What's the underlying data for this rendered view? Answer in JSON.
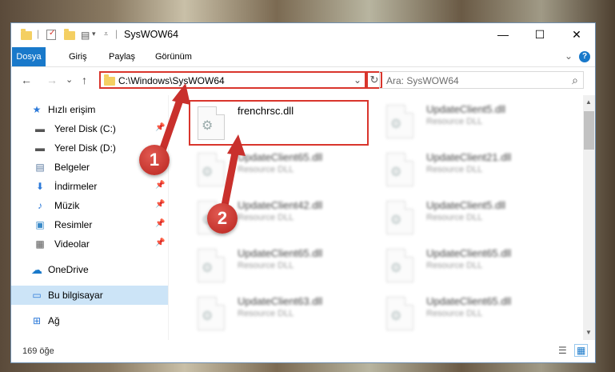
{
  "window": {
    "title": "SysWOW64",
    "minimize": "—",
    "maximize": "☐",
    "close": "✕"
  },
  "ribbon": {
    "tabs": [
      "Dosya",
      "Giriş",
      "Paylaş",
      "Görünüm"
    ],
    "expand": "⌄",
    "help": "?"
  },
  "nav": {
    "back": "←",
    "forward": "→",
    "recent": "⌄",
    "up": "↑",
    "address": "C:\\Windows\\SysWOW64",
    "address_dropdown": "⌄",
    "refresh": "↻",
    "search_placeholder": "Ara: SysWOW64",
    "search_icon": "⌕"
  },
  "sidebar": {
    "items": [
      {
        "label": "Hızlı erişim",
        "icon": "star-icon",
        "glyph": "★"
      },
      {
        "label": "Yerel Disk (C:)",
        "icon": "drive-icon",
        "glyph": "▬"
      },
      {
        "label": "Yerel Disk (D:)",
        "icon": "drive-icon",
        "glyph": "▬"
      },
      {
        "label": "Belgeler",
        "icon": "documents-icon",
        "glyph": "▤"
      },
      {
        "label": "İndirmeler",
        "icon": "download-icon",
        "glyph": "⬇"
      },
      {
        "label": "Müzik",
        "icon": "music-icon",
        "glyph": "♪"
      },
      {
        "label": "Resimler",
        "icon": "pictures-icon",
        "glyph": "▣"
      },
      {
        "label": "Videolar",
        "icon": "videos-icon",
        "glyph": "▦"
      },
      {
        "label": "OneDrive",
        "icon": "cloud-icon",
        "glyph": "☁"
      },
      {
        "label": "Bu bilgisayar",
        "icon": "computer-icon",
        "glyph": "▭"
      },
      {
        "label": "Ağ",
        "icon": "network-icon",
        "glyph": "⊞"
      }
    ],
    "pin": "📌"
  },
  "files": {
    "main": {
      "name": "frenchrsc.dll"
    },
    "right": [
      {
        "name": "UpdateClient5.dll",
        "type": "Resource DLL"
      },
      {
        "name": "UpdateClient21.dll",
        "type": "Resource DLL"
      },
      {
        "name": "UpdateClient5.dll",
        "type": "Resource DLL"
      },
      {
        "name": "UpdateClient65.dll",
        "type": "Resource DLL"
      },
      {
        "name": "UpdateClient65.dll",
        "type": "Resource DLL"
      }
    ],
    "left": [
      {
        "name": "UpdateClient65.dll",
        "type": "Resource DLL"
      },
      {
        "name": "UpdateClient42.dll",
        "type": "Resource DLL"
      },
      {
        "name": "UpdateClient65.dll",
        "type": "Resource DLL"
      },
      {
        "name": "UpdateClient63.dll",
        "type": "Resource DLL"
      }
    ]
  },
  "status": {
    "count": "169 öğe",
    "details_view": "☰",
    "icons_view": "▦"
  },
  "annotations": {
    "step1": "1",
    "step2": "2"
  },
  "colors": {
    "accent": "#1979ca",
    "highlight": "#d9352c",
    "selected": "#cce4f7"
  }
}
